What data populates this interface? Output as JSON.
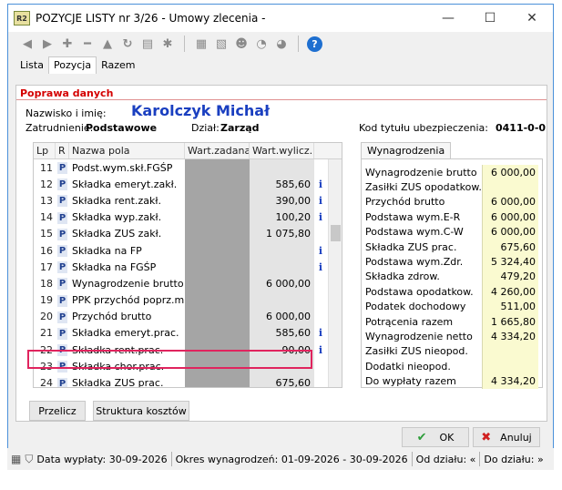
{
  "window": {
    "app_icon": "R2",
    "title": "POZYCJE LISTY nr 3/26 - Umowy zlecenia -",
    "minimize": "—",
    "maximize": "☐",
    "close": "✕"
  },
  "toolbar": {
    "icons": [
      "first-icon",
      "next-icon",
      "add-icon",
      "remove-icon",
      "warning-icon",
      "refresh-icon",
      "print-icon",
      "settings-icon",
      "report-icon",
      "report2-icon",
      "users-icon",
      "history-icon",
      "history2-icon",
      "help-icon"
    ]
  },
  "tabs": [
    "Lista",
    "Pozycja",
    "Razem"
  ],
  "section_title": "Poprawa danych",
  "employee": {
    "name_label": "Nazwisko i imię:",
    "name": "Karolczyk Michał",
    "employment_label": "Zatrudnienie:",
    "employment": "Podstawowe",
    "department_label": "Dział:",
    "department": "Zarząd",
    "insurance_label": "Kod tytułu ubezpieczenia:",
    "insurance": "0411-0-0"
  },
  "grid": {
    "headers": [
      "Lp",
      "R",
      "Nazwa pola",
      "Wart.zadana",
      "Wart.wylicz."
    ],
    "rows": [
      {
        "lp": "11",
        "r": "P",
        "name": "Podst.wym.skł.FGŚP",
        "zad": "",
        "wyl": "",
        "info": ""
      },
      {
        "lp": "12",
        "r": "P",
        "name": "Składka emeryt.zakł.",
        "zad": "",
        "wyl": "585,60",
        "info": "i"
      },
      {
        "lp": "13",
        "r": "P",
        "name": "Składka rent.zakł.",
        "zad": "",
        "wyl": "390,00",
        "info": "i"
      },
      {
        "lp": "14",
        "r": "P",
        "name": "Składka wyp.zakł.",
        "zad": "",
        "wyl": "100,20",
        "info": "i"
      },
      {
        "lp": "15",
        "r": "P",
        "name": "Składka ZUS zakł.",
        "zad": "",
        "wyl": "1 075,80",
        "info": ""
      },
      {
        "lp": "16",
        "r": "P",
        "name": "Składka na FP",
        "zad": "",
        "wyl": "",
        "info": "i"
      },
      {
        "lp": "17",
        "r": "P",
        "name": "Składka na FGŚP",
        "zad": "",
        "wyl": "",
        "info": "i"
      },
      {
        "lp": "18",
        "r": "P",
        "name": "Wynagrodzenie brutto",
        "zad": "",
        "wyl": "6 000,00",
        "info": ""
      },
      {
        "lp": "19",
        "r": "P",
        "name": "PPK przychód poprz.mies.",
        "zad": "",
        "wyl": "",
        "info": ""
      },
      {
        "lp": "20",
        "r": "P",
        "name": "Przychód brutto",
        "zad": "",
        "wyl": "6 000,00",
        "info": ""
      },
      {
        "lp": "21",
        "r": "P",
        "name": "Składka emeryt.prac.",
        "zad": "",
        "wyl": "585,60",
        "info": "i"
      },
      {
        "lp": "22",
        "r": "P",
        "name": "Składka rent.prac.",
        "zad": "",
        "wyl": "90,00",
        "info": "i"
      },
      {
        "lp": "23",
        "r": "P",
        "name": "Składka chor.prac.",
        "zad": "",
        "wyl": "",
        "info": ""
      },
      {
        "lp": "24",
        "r": "P",
        "name": "Składka ZUS prac.",
        "zad": "",
        "wyl": "675,60",
        "info": ""
      }
    ]
  },
  "wynagrodzenia": {
    "tab": "Wynagrodzenia",
    "rows": [
      {
        "label": "Wynagrodzenie brutto",
        "value": "6 000,00"
      },
      {
        "label": "Zasiłki ZUS opodatkow.",
        "value": ""
      },
      {
        "label": "Przychód brutto",
        "value": "6 000,00"
      },
      {
        "label": "Podstawa wym.E-R",
        "value": "6 000,00"
      },
      {
        "label": "Podstawa wym.C-W",
        "value": "6 000,00"
      },
      {
        "label": "Składka ZUS prac.",
        "value": "675,60"
      },
      {
        "label": "Podstawa wym.Zdr.",
        "value": "5 324,40"
      },
      {
        "label": "Składka zdrow.",
        "value": "479,20"
      },
      {
        "label": "Podstawa opodatkow.",
        "value": "4 260,00"
      },
      {
        "label": "Podatek dochodowy",
        "value": "511,00"
      },
      {
        "label": "Potrącenia razem",
        "value": "1 665,80"
      },
      {
        "label": "Wynagrodzenie netto",
        "value": "4 334,20"
      },
      {
        "label": "Zasiłki ZUS nieopod.",
        "value": ""
      },
      {
        "label": "Dodatki nieopod.",
        "value": ""
      },
      {
        "label": "Do wypłaty razem",
        "value": "4 334,20"
      }
    ]
  },
  "buttons": {
    "przelicz": "Przelicz",
    "struktura": "Struktura kosztów",
    "ok": "OK",
    "anuluj": "Anuluj"
  },
  "status": {
    "data_wyplaty": "Data wypłaty: 30-09-2026",
    "okres": "Okres wynagrodzeń: 01-09-2026 - 30-09-2026",
    "od_dzialu": "Od działu: «",
    "do_dzialu": "Do działu: »"
  },
  "colors": {
    "accent": "#1a3fc0",
    "section_red": "#d40000",
    "highlight": "#e0245e"
  }
}
